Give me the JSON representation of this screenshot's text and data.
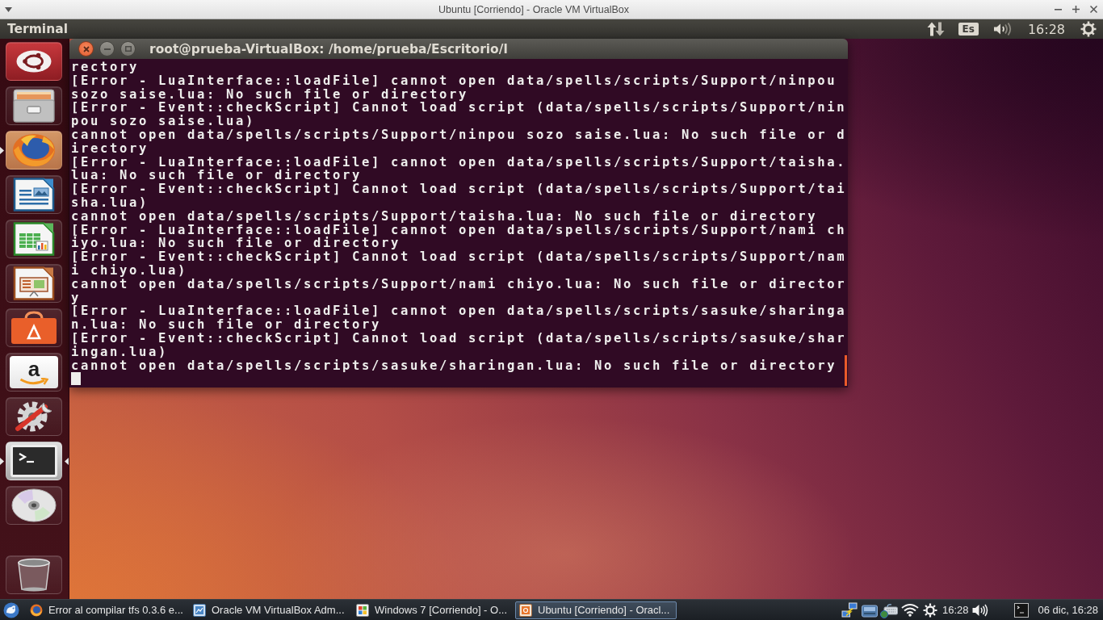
{
  "host_window": {
    "title": "Ubuntu [Corriendo] - Oracle VM VirtualBox"
  },
  "top_panel": {
    "app_title": "Terminal",
    "keyboard_layout": "Es",
    "clock": "16:28"
  },
  "launcher": {
    "items": [
      {
        "kind": "dash",
        "running": false,
        "focused": false
      },
      {
        "kind": "files",
        "running": false,
        "focused": false
      },
      {
        "kind": "browser",
        "running": true,
        "focused": false
      },
      {
        "kind": "writer",
        "running": false,
        "focused": false
      },
      {
        "kind": "calc",
        "running": false,
        "focused": false
      },
      {
        "kind": "impress",
        "running": false,
        "focused": false
      },
      {
        "kind": "software",
        "running": false,
        "focused": false
      },
      {
        "kind": "store",
        "glyph": "a",
        "running": false,
        "focused": false
      },
      {
        "kind": "settings",
        "running": false,
        "focused": false
      },
      {
        "kind": "terminal",
        "running": true,
        "focused": true
      },
      {
        "kind": "disc",
        "running": false,
        "focused": false
      },
      {
        "kind": "trash",
        "running": false,
        "focused": false
      }
    ]
  },
  "terminal": {
    "title": "root@prueba-VirtualBox: /home/prueba/Escritorio/l",
    "lines": [
      "rectory",
      "[Error - LuaInterface::loadFile] cannot open data/spells/scripts/Support/ninpou",
      "sozo saise.lua: No such file or directory",
      "[Error - Event::checkScript] Cannot load script (data/spells/scripts/Support/nin",
      "pou sozo saise.lua)",
      "cannot open data/spells/scripts/Support/ninpou sozo saise.lua: No such file or d",
      "irectory",
      "[Error - LuaInterface::loadFile] cannot open data/spells/scripts/Support/taisha.",
      "lua: No such file or directory",
      "[Error - Event::checkScript] Cannot load script (data/spells/scripts/Support/tai",
      "sha.lua)",
      "cannot open data/spells/scripts/Support/taisha.lua: No such file or directory",
      "[Error - LuaInterface::loadFile] cannot open data/spells/scripts/Support/nami ch",
      "iyo.lua: No such file or directory",
      "[Error - Event::checkScript] Cannot load script (data/spells/scripts/Support/nam",
      "i chiyo.lua)",
      "cannot open data/spells/scripts/Support/nami chiyo.lua: No such file or director",
      "y",
      "[Error - LuaInterface::loadFile] cannot open data/spells/scripts/sasuke/sharinga",
      "n.lua: No such file or directory",
      "[Error - Event::checkScript] Cannot load script (data/spells/scripts/sasuke/shar",
      "ingan.lua)",
      "cannot open data/spells/scripts/sasuke/sharingan.lua: No such file or directory"
    ]
  },
  "taskbar": {
    "tasks": [
      {
        "kind": "browser",
        "label": "Error al compilar tfs 0.3.6 e...",
        "selected": false
      },
      {
        "kind": "manager",
        "label": "Oracle VM VirtualBox Adm...",
        "selected": false
      },
      {
        "kind": "winguest",
        "label": "Windows 7 [Corriendo] - O...",
        "selected": false
      },
      {
        "kind": "linuxguest",
        "label": "Ubuntu [Corriendo] - Oracl...",
        "selected": true
      }
    ],
    "clock": "16:28",
    "date_time": "06 dic, 16:28"
  }
}
